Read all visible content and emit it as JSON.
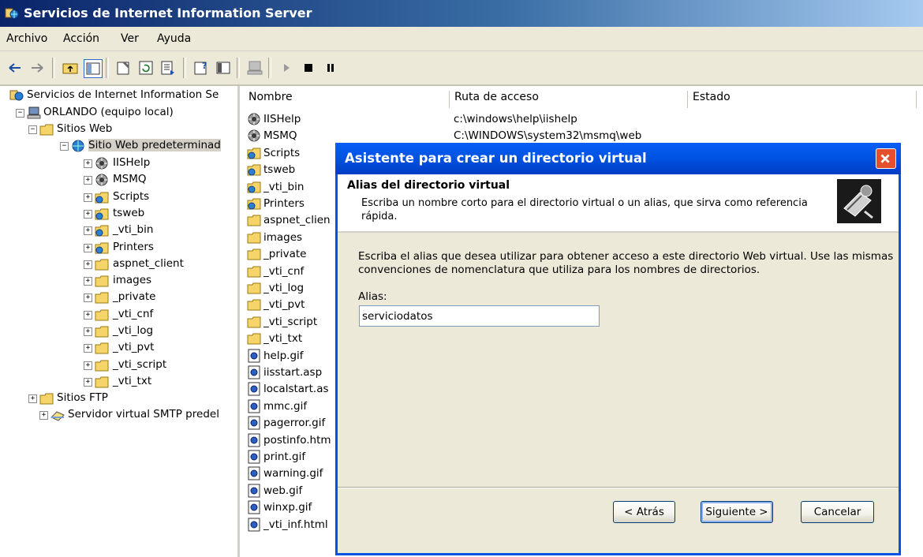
{
  "window": {
    "title": "Servicios de Internet Information Server"
  },
  "menu": [
    "Archivo",
    "Acción",
    "Ver",
    "Ayuda"
  ],
  "tree": {
    "root": "Servicios de Internet Information Se",
    "computer": "ORLANDO (equipo local)",
    "web_sites": "Sitios Web",
    "default_site": "Sitio Web predeterminad",
    "children": [
      "IISHelp",
      "MSMQ",
      "Scripts",
      "tsweb",
      "_vti_bin",
      "Printers",
      "aspnet_client",
      "images",
      "_private",
      "_vti_cnf",
      "_vti_log",
      "_vti_pvt",
      "_vti_script",
      "_vti_txt"
    ],
    "ftp_sites": "Sitios FTP",
    "smtp": "Servidor virtual SMTP predel"
  },
  "list": {
    "columns": [
      "Nombre",
      "Ruta de acceso",
      "Estado"
    ],
    "rows": [
      {
        "name": "IISHelp",
        "path": "c:\\windows\\help\\iishelp",
        "icon": "globe-icon"
      },
      {
        "name": "MSMQ",
        "path": "C:\\WINDOWS\\system32\\msmq\\web",
        "icon": "globe-icon"
      },
      {
        "name": "Scripts",
        "path": "",
        "icon": "virtual-folder-icon"
      },
      {
        "name": "tsweb",
        "path": "",
        "icon": "virtual-folder-icon"
      },
      {
        "name": "_vti_bin",
        "path": "",
        "icon": "virtual-folder-icon"
      },
      {
        "name": "Printers",
        "path": "",
        "icon": "virtual-folder-icon"
      },
      {
        "name": "aspnet_clien",
        "path": "",
        "icon": "folder-icon"
      },
      {
        "name": "images",
        "path": "",
        "icon": "folder-icon"
      },
      {
        "name": "_private",
        "path": "",
        "icon": "folder-icon"
      },
      {
        "name": "_vti_cnf",
        "path": "",
        "icon": "folder-icon"
      },
      {
        "name": "_vti_log",
        "path": "",
        "icon": "folder-icon"
      },
      {
        "name": "_vti_pvt",
        "path": "",
        "icon": "folder-icon"
      },
      {
        "name": "_vti_script",
        "path": "",
        "icon": "folder-icon"
      },
      {
        "name": "_vti_txt",
        "path": "",
        "icon": "folder-icon"
      },
      {
        "name": "help.gif",
        "path": "",
        "icon": "file-icon"
      },
      {
        "name": "iisstart.asp",
        "path": "",
        "icon": "file-icon"
      },
      {
        "name": "localstart.as",
        "path": "",
        "icon": "file-icon"
      },
      {
        "name": "mmc.gif",
        "path": "",
        "icon": "file-icon"
      },
      {
        "name": "pagerror.gif",
        "path": "",
        "icon": "file-icon"
      },
      {
        "name": "postinfo.htm",
        "path": "",
        "icon": "file-icon"
      },
      {
        "name": "print.gif",
        "path": "",
        "icon": "file-icon"
      },
      {
        "name": "warning.gif",
        "path": "",
        "icon": "file-icon"
      },
      {
        "name": "web.gif",
        "path": "",
        "icon": "file-icon"
      },
      {
        "name": "winxp.gif",
        "path": "",
        "icon": "file-icon"
      },
      {
        "name": "_vti_inf.html",
        "path": "",
        "icon": "file-icon"
      }
    ]
  },
  "dialog": {
    "title": "Asistente para crear un directorio virtual",
    "header_title": "Alias del directorio virtual",
    "header_subtitle": "Escriba un nombre corto para el directorio virtual o un alias, que sirva como referencia rápida.",
    "description": "Escriba el alias que desea utilizar para obtener acceso a este directorio Web virtual. Use las mismas convenciones de nomenclatura que utiliza para los nombres de directorios.",
    "alias_label": "Alias:",
    "alias_value": "serviciodatos",
    "back_label": "< Atrás",
    "next_label": "Siguiente >",
    "cancel_label": "Cancelar"
  },
  "colors": {
    "titlebar": "#0a246a",
    "dialog_title": "#0054e3",
    "chrome": "#ece9d8"
  }
}
